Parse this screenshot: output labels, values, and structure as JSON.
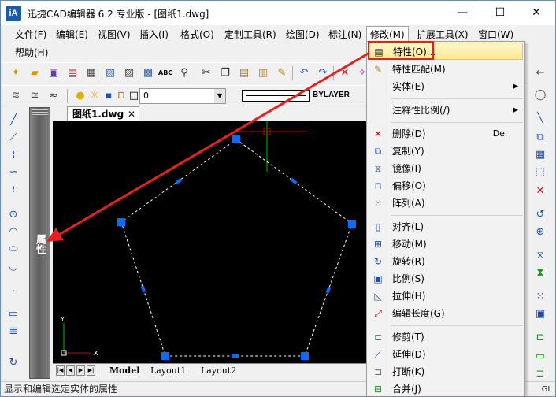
{
  "window": {
    "app_icon_text": "iA",
    "title": "迅捷CAD编辑器 6.2 专业版  - [图纸1.dwg]",
    "minimize": "—",
    "maximize": "☐",
    "close": "✕"
  },
  "menubar": {
    "items": [
      {
        "label": "文件(F)"
      },
      {
        "label": "编辑(E)"
      },
      {
        "label": "视图(V)"
      },
      {
        "label": "插入(I)"
      },
      {
        "label": "格式(O)"
      },
      {
        "label": "定制工具(R)"
      },
      {
        "label": "绘图(D)"
      },
      {
        "label": "标注(N)"
      },
      {
        "label": "修改(M)"
      },
      {
        "label": "扩展工具(X)"
      },
      {
        "label": "窗口(W)"
      },
      {
        "label": "帮助(H)"
      }
    ]
  },
  "toolbar2": {
    "layer_value": "0",
    "linetype_value": "BYLAYER"
  },
  "props_panel": {
    "label": "属性"
  },
  "document_tab": {
    "label": "图纸1.dwg",
    "close": "✕"
  },
  "layout_tabs": {
    "tabs": [
      "Model",
      "Layout1",
      "Layout2"
    ]
  },
  "canvas": {
    "axis_x": "X",
    "axis_y": "Y"
  },
  "dropdown": {
    "items": [
      {
        "label": "特性(O)...",
        "shortcut": "",
        "submenu": false
      },
      {
        "label": "特性匹配(M)",
        "shortcut": "",
        "submenu": false
      },
      {
        "label": "实体(E)",
        "shortcut": "",
        "submenu": true
      },
      {
        "label": "注释性比例(/)",
        "shortcut": "",
        "submenu": true
      },
      {
        "label": "删除(D)",
        "shortcut": "Del",
        "submenu": false
      },
      {
        "label": "复制(Y)",
        "shortcut": "",
        "submenu": false
      },
      {
        "label": "镜像(I)",
        "shortcut": "",
        "submenu": false
      },
      {
        "label": "偏移(O)",
        "shortcut": "",
        "submenu": false
      },
      {
        "label": "阵列(A)",
        "shortcut": "",
        "submenu": false
      },
      {
        "label": "对齐(L)",
        "shortcut": "",
        "submenu": false
      },
      {
        "label": "移动(M)",
        "shortcut": "",
        "submenu": false
      },
      {
        "label": "旋转(R)",
        "shortcut": "",
        "submenu": false
      },
      {
        "label": "比例(S)",
        "shortcut": "",
        "submenu": false
      },
      {
        "label": "拉伸(H)",
        "shortcut": "",
        "submenu": false
      },
      {
        "label": "编辑长度(G)",
        "shortcut": "",
        "submenu": false
      },
      {
        "label": "修剪(T)",
        "shortcut": "",
        "submenu": false
      },
      {
        "label": "延伸(D)",
        "shortcut": "",
        "submenu": false
      },
      {
        "label": "打断(K)",
        "shortcut": "",
        "submenu": false
      },
      {
        "label": "合并(J)",
        "shortcut": "",
        "submenu": false
      }
    ]
  },
  "statusbar": {
    "text": "显示和编辑选定实体的属性",
    "right": "GL"
  },
  "colors": {
    "highlight_red": "#e8201d",
    "grip_blue": "#0a6cff",
    "canvas_bg": "#000000"
  }
}
